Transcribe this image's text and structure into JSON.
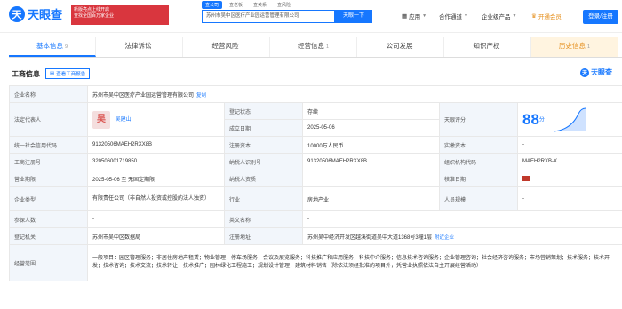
{
  "brand": {
    "name": "天眼查",
    "mark": "天"
  },
  "promo": {
    "line1": "新版亮点上线开启",
    "line2": "查找全国百万家企业"
  },
  "search": {
    "tabs": [
      "查公司",
      "查老板",
      "查关系",
      "查风险"
    ],
    "value": "苏州市吴中区医疗产业园运营管理有限公司",
    "button": "天眼一下"
  },
  "nav": {
    "app": "应用",
    "cooperation": "合作通道",
    "products": "企业级产品",
    "vip": "开通会员",
    "login": "登录/注册"
  },
  "tabs": [
    {
      "label": "基本信息",
      "count": "9"
    },
    {
      "label": "法律诉讼",
      "count": ""
    },
    {
      "label": "经营风险",
      "count": ""
    },
    {
      "label": "经营信息",
      "count": "1"
    },
    {
      "label": "公司发展",
      "count": ""
    },
    {
      "label": "知识产权",
      "count": ""
    },
    {
      "label": "历史信息",
      "count": "1"
    }
  ],
  "section": {
    "title": "工商信息",
    "report_button": "查看工商报告"
  },
  "watermark": "天眼查",
  "info": {
    "company_name_label": "企业名称",
    "company_name": "苏州市吴中区医疗产业园运营管理有限公司",
    "company_name_action": "复制",
    "legal_rep_label": "法定代表人",
    "legal_rep_avatar": "吴",
    "legal_rep": "吴建山",
    "reg_status_label": "登记状态",
    "reg_status": "存续",
    "tianyan_score_label": "天眼评分",
    "tianyan_score": "88",
    "tianyan_score_unit": "分",
    "est_date_label": "成立日期",
    "est_date": "2025-05-06",
    "credit_code_label": "统一社会信用代码",
    "credit_code": "91320506MAEH2RXX8B",
    "reg_capital_label": "注册资本",
    "reg_capital": "10000万人民币",
    "paid_capital_label": "实缴资本",
    "paid_capital": "-",
    "biz_reg_no_label": "工商注册号",
    "biz_reg_no": "320506001719850",
    "taxpayer_id_label": "纳税人识别号",
    "taxpayer_id": "91320506MAEH2RXX8B",
    "org_code_label": "组织机构代码",
    "org_code": "MAEH2RXB-X",
    "biz_term_label": "营业期限",
    "biz_term": "2025-05-06 至 无固定期限",
    "taxpayer_qual_label": "纳税人资质",
    "taxpayer_qual": "-",
    "approve_date_label": "核准日期",
    "approve_date": "",
    "company_type_label": "企业类型",
    "company_type": "有限责任公司（非自然人投资或控股的法人独资）",
    "industry_label": "行业",
    "industry": "房地产业",
    "staff_size_label": "人员规模",
    "staff_size": "-",
    "insured_label": "参保人数",
    "insured": "-",
    "english_name_label": "英文名称",
    "english_name": "-",
    "reg_authority_label": "登记机关",
    "reg_authority": "苏州市吴中区数据局",
    "reg_address_label": "注册地址",
    "reg_address": "苏州吴中经济开发区越溪街道吴中大道1368号3幢1层",
    "reg_address_action": "附近企业",
    "scope_label": "经营范围",
    "scope": "一般项目：园区管理服务；非居住房地产租赁；物业管理；停车场服务；会议及展览服务；科技推广和应用服务；科技中介服务；信息技术咨询服务；企业管理咨询；社会经济咨询服务；市场营销策划；技术服务；技术开发；技术咨询；技术交流；技术转让；技术推广；园林绿化工程施工；规划设计管理；建筑材料销售（除依法须经批准的项目外，凭营业执照依法自主开展经营活动）"
  },
  "colors": {
    "brand": "#1677ff",
    "promo": "#d9363e",
    "label_bg": "#f2f6fb",
    "vip": "#e58e1a"
  }
}
